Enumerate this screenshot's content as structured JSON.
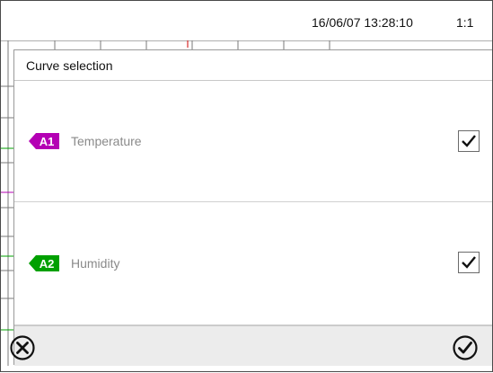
{
  "status_bar": {
    "datetime": "16/06/07 13:28:10",
    "page": "1:1"
  },
  "dialog": {
    "title": "Curve selection",
    "curves": [
      {
        "badge": "A1",
        "label": "Temperature",
        "color": "#b400b4",
        "checked": true
      },
      {
        "badge": "A2",
        "label": "Humidity",
        "color": "#00a000",
        "checked": true
      }
    ]
  },
  "footer": {
    "cancel_icon": "close-circle-icon",
    "confirm_icon": "check-circle-icon"
  }
}
